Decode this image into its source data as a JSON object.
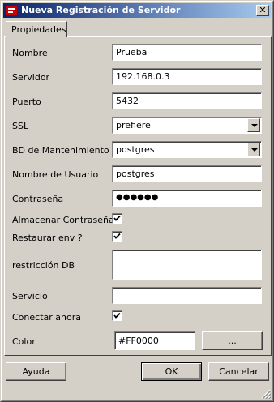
{
  "window": {
    "title": "Nueva Registración de Servidor",
    "close_glyph": "✕"
  },
  "tabs": [
    {
      "label": "Propiedades"
    }
  ],
  "form": {
    "nombre": {
      "label": "Nombre",
      "value": "Prueba"
    },
    "servidor": {
      "label": "Servidor",
      "value": "192.168.0.3"
    },
    "puerto": {
      "label": "Puerto",
      "value": "5432"
    },
    "ssl": {
      "label": "SSL",
      "value": "prefiere"
    },
    "bd": {
      "label": "BD de Mantenimiento",
      "value": "postgres"
    },
    "usuario": {
      "label": "Nombre de Usuario",
      "value": "postgres"
    },
    "password": {
      "label": "Contraseña",
      "value": "●●●●●●"
    },
    "almacenar": {
      "label": "Almacenar Contraseña",
      "checked": true
    },
    "restaurar": {
      "label": "Restaurar env ?",
      "checked": true
    },
    "restriccion": {
      "label": "restricción DB",
      "value": ""
    },
    "servicio": {
      "label": "Servicio",
      "value": ""
    },
    "conectar": {
      "label": "Conectar ahora",
      "checked": true
    },
    "color": {
      "label": "Color",
      "value": "#FF0000",
      "button_label": "..."
    }
  },
  "buttons": {
    "help": "Ayuda",
    "ok": "OK",
    "cancel": "Cancelar"
  },
  "icons": {
    "title_icon": "elephant-icon",
    "checkmark": "checkmark-icon",
    "resize": "resize-grip-icon"
  },
  "colors": {
    "title_start": "#0a246a",
    "title_end": "#a6caf0",
    "face": "#d4d0c8",
    "app_icon": "#cc0000"
  }
}
